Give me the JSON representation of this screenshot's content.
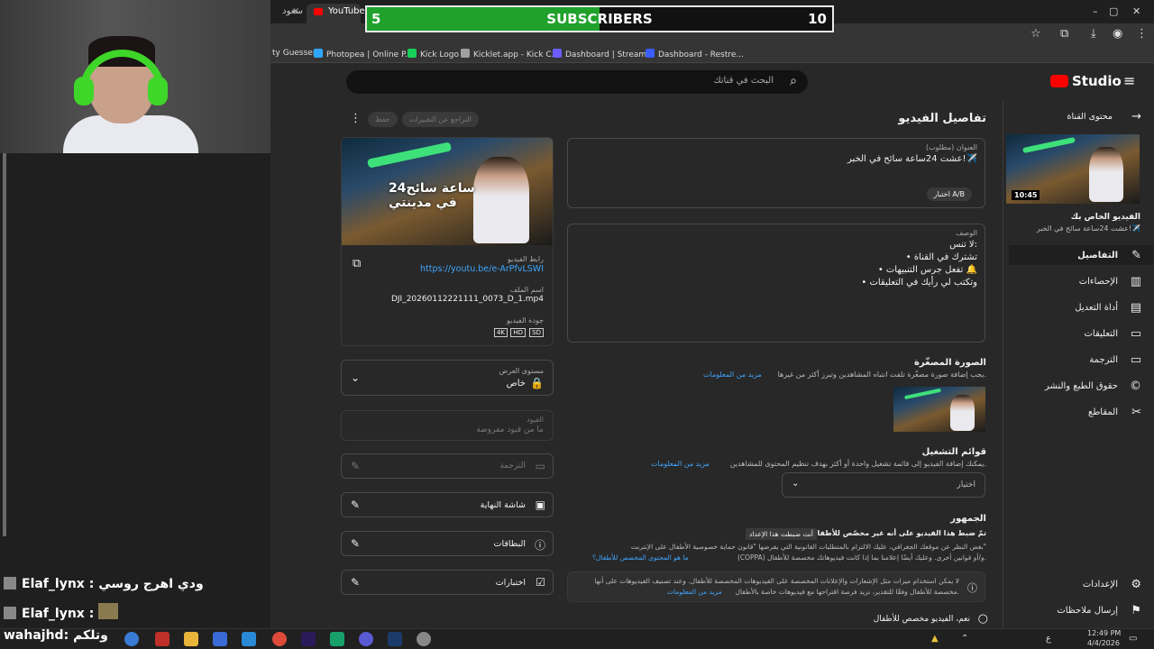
{
  "overlay": {
    "subs_current": "5",
    "subs_label": "SUBSCRIBERS",
    "subs_goal": "10",
    "progress_fraction": 0.5
  },
  "browser": {
    "tabs": [
      "سعود",
      "YouTube St"
    ],
    "bookmarks": [
      "ty Guesser",
      "Photopea | Online P...",
      "Kick Logo",
      "Kicklet.app - Kick C...",
      "Dashboard | Stream...",
      "Dashboard - Restre..."
    ],
    "bookmark_colors": [
      "#2fa6ff",
      "#18cf5a",
      "#a0a0a0",
      "#6b5cff",
      "#3b5cff"
    ]
  },
  "studio": {
    "logo": "Studio",
    "search_placeholder": "البحث في قناتك",
    "page_title": "تفاصيل الفيديو",
    "undo_btn": "التراجع عن التغييرات",
    "save_btn": "حفظ"
  },
  "sidebar": {
    "back_label": "محتوى القناة",
    "duration": "10:45",
    "video_heading": "الفيديو الخاص بك",
    "video_title": "عشت 24ساعة سائح في الخبر!✈️",
    "items": [
      "التفاصيل",
      "الإحصاءات",
      "أداة التعديل",
      "التعليقات",
      "الترجمة",
      "حقوق الطبع والنشر",
      "المقاطع"
    ],
    "settings": "الإعدادات",
    "feedback": "إرسال ملاحظات"
  },
  "form": {
    "title_label": "العنوان (مطلوب)",
    "title_value": "عشت 24ساعة سائح في الخبر!✈️",
    "ab_button": "اختبار A/B",
    "desc_label": "الوصف",
    "desc_lines": [
      "لا تنس:",
      "• تشترك في القناة",
      "• تفعل جرس التنبيهات 🔔",
      "• وتكتب لي رأيك في التعليقات"
    ],
    "thumb_heading": "الصورة المصغّرة",
    "thumb_desc": "يجب إضافة صورة مصغّرة تلفت انتباه المشاهدين وتبرز أكثر من غيرها.",
    "learn_more": "مزيد من المعلومات",
    "playlists_heading": "قوائم التشغيل",
    "playlists_desc": "يمكنك إضافة الفيديو إلى قائمة تشغيل واحدة أو أكثر بهدف تنظيم المحتوى للمشاهدين.",
    "playlist_select": "اختيار",
    "audience_heading": "الجمهور",
    "audience_set": "تمّ ضبط هذا الفيديو على أنه غير مخصّص للأطفال",
    "audience_chip": "أنت ضبطت هذا الإعداد",
    "audience_desc1": "بغض النظر عن موقعك الجغرافي، عليك الالتزام بالمتطلبات القانونية التي يفرضها \"قانون حماية خصوصية الأطفال على الإنترنت\"",
    "audience_desc2": "(COPPA) و/أو قوانين أخرى. وعليك أيضًا إعلامنا بما إذا كانت فيديوهاتك مخصصة للأطفال.",
    "audience_link": "ما هو المحتوى المخصص للأطفال؟",
    "info_box1": "لا يمكن استخدام ميزات مثل الإشعارات والإعلانات المخصصة على الفيديوهات المخصصة للأطفال. وعند تصنيف الفيديوهات على أنها",
    "info_box2": "مخصصة للأطفال وفقًا للتقدير، تزيد فرصة اقتراحها مع فيديوهات خاصة بالأطفال.",
    "radio_yes": "نعم، الفيديو مخصص للأطفال"
  },
  "video_card": {
    "thumb_title": "24ساعة سائح\nفي مدينتي",
    "link_label": "رابط الفيديو",
    "link_value": "https://youtu.be/e-ArPfvLSWI",
    "file_label": "اسم الملف",
    "file_value": "DJI_20260112221111_0073_D_1.mp4",
    "quality_label": "جودة الفيديو",
    "quality_badges": [
      "4K",
      "HD",
      "SD"
    ]
  },
  "left_panels": {
    "visibility_label": "مستوى العرض",
    "visibility_value": "خاص",
    "restrictions_label": "القيود",
    "restrictions_value": "ما من قيود مفروضة",
    "subtitles": "الترجمة",
    "end_screen": "شاشة النهاية",
    "cards": "البطاقات",
    "tests": "اختبارات"
  },
  "chat": [
    {
      "user": "Elaf_lynx",
      "msg": "ودي اهرج روسي"
    },
    {
      "user": "Elaf_lynx",
      "msg": ""
    },
    {
      "user": "wahajhd",
      "msg": "وتلكم"
    }
  ],
  "taskbar": {
    "time": "12:49 PM",
    "date": "4/4/2026"
  }
}
